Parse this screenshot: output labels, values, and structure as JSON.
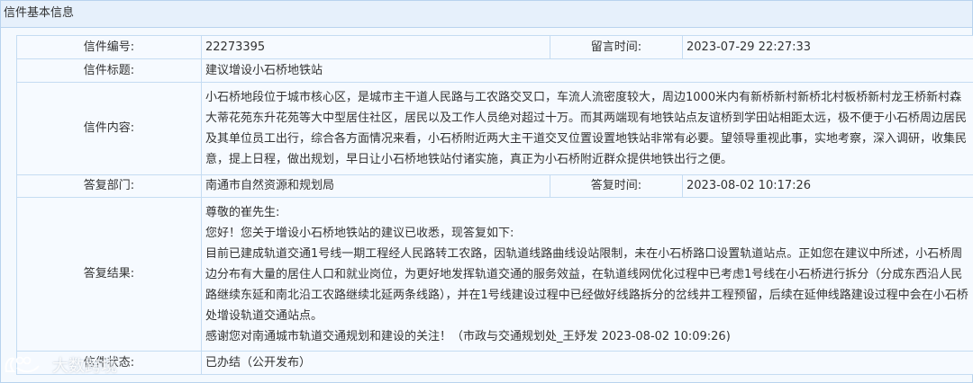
{
  "panel": {
    "title": "信件基本信息"
  },
  "letter": {
    "number_label": "信件编号:",
    "number": "22273395",
    "time_label": "留言时间:",
    "time": "2023-07-29 22:27:33",
    "title_label": "信件标题:",
    "title": "建议增设小石桥地铁站",
    "content_label": "信件内容:",
    "content": "小石桥地段位于城市核心区，是城市主干道人民路与工农路交叉口，车流人流密度较大，周边1000米内有新桥新村新桥北村板桥新村龙王桥新村森大蒂花苑东升花苑等大中型居住社区，居民以及工作人员绝对超过十万。而其两端现有地铁站点友谊桥到学田站相距太远，极不便于小石桥周边居民及其单位员工出行，综合各方面情况来看，小石桥附近两大主干道交叉位置设置地铁站非常有必要。望领导重视此事，实地考察，深入调研，收集民意，提上日程，做出规划，早日让小石桥地铁站付诸实施，真正为小石桥附近群众提供地铁出行之便。"
  },
  "reply": {
    "dept_label": "答复部门:",
    "dept": "南通市自然资源和规划局",
    "time_label": "答复时间:",
    "time": "2023-08-02 10:17:26",
    "result_label": "答复结果:",
    "lines": [
      "尊敬的崔先生:",
      "您好！您关于增设小石桥地铁站的建议已收悉，现答复如下:",
      "目前已建成轨道交通1号线一期工程经人民路转工农路，因轨道线路曲线设站限制，未在小石桥路口设置轨道站点。正如您在建议中所述，小石桥周边分布有大量的居住人口和就业岗位，为更好地发挥轨道交通的服务效益，在轨道线网优化过程中已考虑1号线在小石桥进行拆分（分成东西沿人民路继续东延和南北沿工农路继续北延两条线路），并在1号线建设过程中已经做好线路拆分的岔线井工程预留，后续在延伸线路建设过程中会在小石桥处增设轨道交通站点。",
      "感谢您对南通城市轨道交通规划和建设的关注！（市政与交通规划处_王妤发 2023-08-02 10:09:26)"
    ],
    "status_label": "信件状态:",
    "status": "已办结（公开发布）"
  },
  "watermark": {
    "text": "大数跨境",
    "icon": "brand-logo-icon"
  }
}
